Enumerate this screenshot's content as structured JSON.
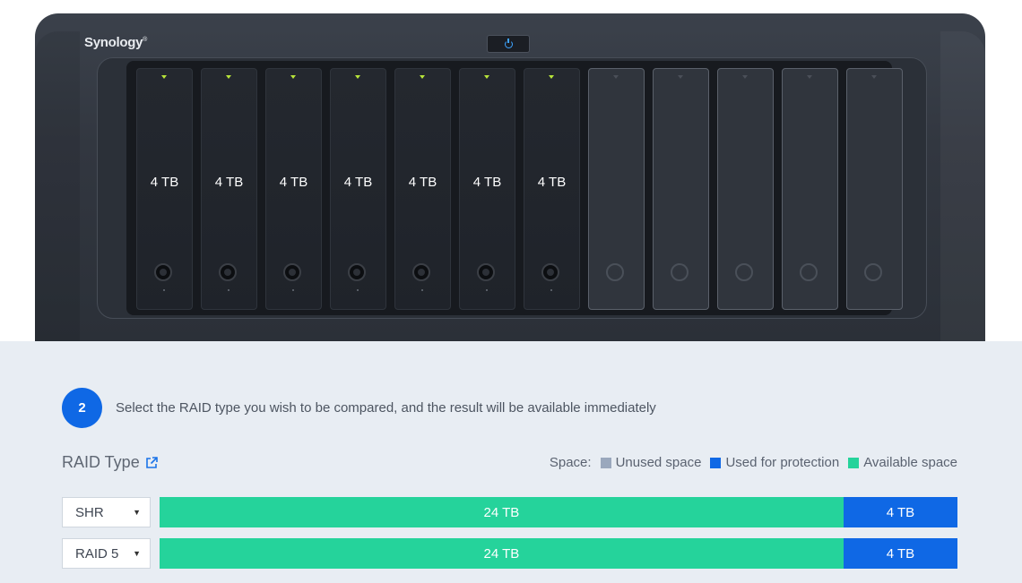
{
  "device": {
    "brand": "Synology",
    "brand_mark": "®",
    "power_icon": "power-icon",
    "drives": [
      {
        "label": "4 TB",
        "installed": true
      },
      {
        "label": "4 TB",
        "installed": true
      },
      {
        "label": "4 TB",
        "installed": true
      },
      {
        "label": "4 TB",
        "installed": true
      },
      {
        "label": "4 TB",
        "installed": true
      },
      {
        "label": "4 TB",
        "installed": true
      },
      {
        "label": "4 TB",
        "installed": true
      },
      {
        "label": "",
        "installed": false
      },
      {
        "label": "",
        "installed": false
      },
      {
        "label": "",
        "installed": false
      },
      {
        "label": "",
        "installed": false
      },
      {
        "label": "",
        "installed": false
      }
    ]
  },
  "step": {
    "number": "2",
    "instruction": "Select the RAID type you wish to be compared, and the result will be available immediately"
  },
  "raid_section": {
    "title": "RAID Type",
    "link_icon": "external-link-icon"
  },
  "legend": {
    "label": "Space:",
    "items": [
      {
        "label": "Unused space",
        "color": "#9aa8bd"
      },
      {
        "label": "Used for protection",
        "color": "#0f68e5"
      },
      {
        "label": "Available space",
        "color": "#25d39b"
      }
    ]
  },
  "rows": [
    {
      "raid_type": "SHR",
      "available": {
        "label": "24 TB",
        "tb": 24,
        "color": "#25d39b"
      },
      "protection": {
        "label": "4 TB",
        "tb": 4,
        "color": "#0f68e5"
      }
    },
    {
      "raid_type": "RAID 5",
      "available": {
        "label": "24 TB",
        "tb": 24,
        "color": "#25d39b"
      },
      "protection": {
        "label": "4 TB",
        "tb": 4,
        "color": "#0f68e5"
      }
    }
  ]
}
